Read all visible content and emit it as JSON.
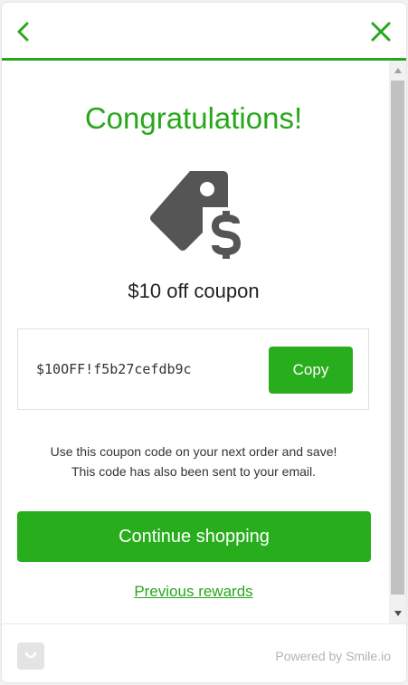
{
  "header": {
    "back_icon": "chevron-left-icon",
    "close_icon": "close-icon",
    "accent_color": "#28a71b"
  },
  "reward": {
    "title": "Congratulations!",
    "icon": "price-tag-dollar-icon",
    "name": "$10 off coupon",
    "code": "$10OFF!f5b27cefdb9c",
    "copy_label": "Copy",
    "note_line1": "Use this coupon code on your next order and save!",
    "note_line2": "This code has also been sent to your email."
  },
  "actions": {
    "continue_label": "Continue shopping",
    "previous_label": "Previous rewards"
  },
  "footer": {
    "logo_icon": "smile-logo-icon",
    "powered_by": "Powered by Smile.io"
  }
}
